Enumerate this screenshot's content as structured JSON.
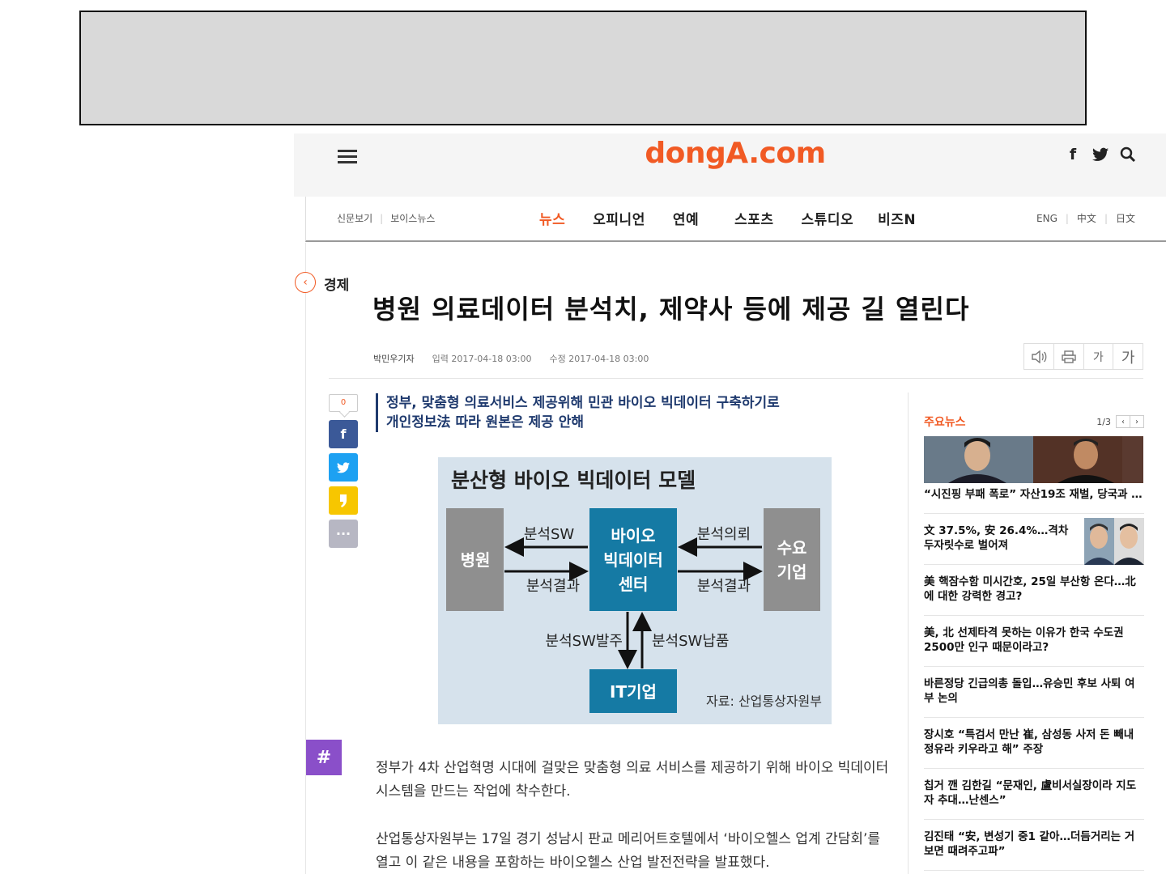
{
  "site": {
    "logo": "dongA.com",
    "top_icons": [
      "facebook-icon",
      "twitter-icon",
      "search-icon"
    ]
  },
  "nav": {
    "left": [
      "신문보기",
      "보이스뉴스"
    ],
    "main": [
      {
        "label": "뉴스",
        "active": true
      },
      {
        "label": "오피니언",
        "active": false
      },
      {
        "label": "연예",
        "active": false
      },
      {
        "label": "스포츠",
        "active": false
      },
      {
        "label": "스튜디오",
        "active": false
      },
      {
        "label": "비즈N",
        "active": false
      }
    ],
    "right": [
      "ENG",
      "中文",
      "日文"
    ]
  },
  "article": {
    "section": "경제",
    "headline": "병원 의료데이터 분석치, 제약사 등에 제공 길 열린다",
    "reporter": "박민우기자",
    "input_date": "입력 2017-04-18 03:00",
    "modified_date": "수정 2017-04-18 03:00",
    "tools": {
      "font_small": "가",
      "font_large": "가"
    },
    "share_count": "0",
    "hashtag": "#",
    "summary": [
      "정부, 맞춤형 의료서비스 제공위해 민관 바이오 빅데이터 구축하기로",
      "개인정보法 따라 원본은 제공 안해"
    ],
    "figure": {
      "title": "분산형 바이오 빅데이터 모델",
      "hospital": "병원",
      "center": [
        "바이오",
        "빅데이터",
        "센터"
      ],
      "demand": [
        "수요",
        "기업"
      ],
      "it": "IT기업",
      "arrow_top_left": "분석SW",
      "arrow_bottom_left": "분석결과",
      "arrow_top_right": "분석의뢰",
      "arrow_bottom_right": "분석결과",
      "arrow_down": "분석SW발주",
      "arrow_up": "분석SW납품",
      "source": "자료: 산업통상자원부"
    },
    "paragraphs": [
      "정부가 4차 산업혁명 시대에 걸맞은 맞춤형 의료 서비스를 제공하기 위해 바이오 빅데이터 시스템을 만드는 작업에 착수한다.",
      "산업통상자원부는 17일 경기 성남시 판교 메리어트호텔에서 ‘바이오헬스 업계 간담회’를 열고 이 같은 내용을 포함하는 바이오헬스 산업 발전전략을 발표했다."
    ]
  },
  "sidebar": {
    "title": "주요뉴스",
    "pager": "1/3",
    "items": [
      "“시진핑 부패 폭로” 자산19조 재벌, 당국과 …",
      "文 37.5%, 安 26.4%…격차 두자릿수로 벌어져",
      "美 핵잠수함 미시간호, 25일 부산항 온다…北에 대한 강력한 경고?",
      "美, 北 선제타격 못하는 이유가 한국 수도권 2500만 인구 때문이라고?",
      "바른정당 긴급의총 돌입…유승민 후보 사퇴 여부 논의",
      "장시호 “특검서 만난 崔, 삼성동 사저 돈 빼내 정유라 키우라고 해” 주장",
      "칩거 깬 김한길 “문재인, 盧비서실장이라 지도자 추대…난센스”",
      "김진태 “安, 변성기 중1 같아…더듬거리는 거 보면 때려주고파”"
    ]
  },
  "colors": {
    "brand": "#f15a24",
    "summary_blue": "#1f3a6e",
    "facebook": "#3b5998",
    "twitter": "#1da1f2",
    "kakao": "#f7c600",
    "more": "#b7b7c3",
    "hashtag": "#8a4fc9",
    "figure_bg": "#d6e2ec",
    "figure_box_gray": "#8f8f8f",
    "figure_box_teal": "#157aa4"
  }
}
